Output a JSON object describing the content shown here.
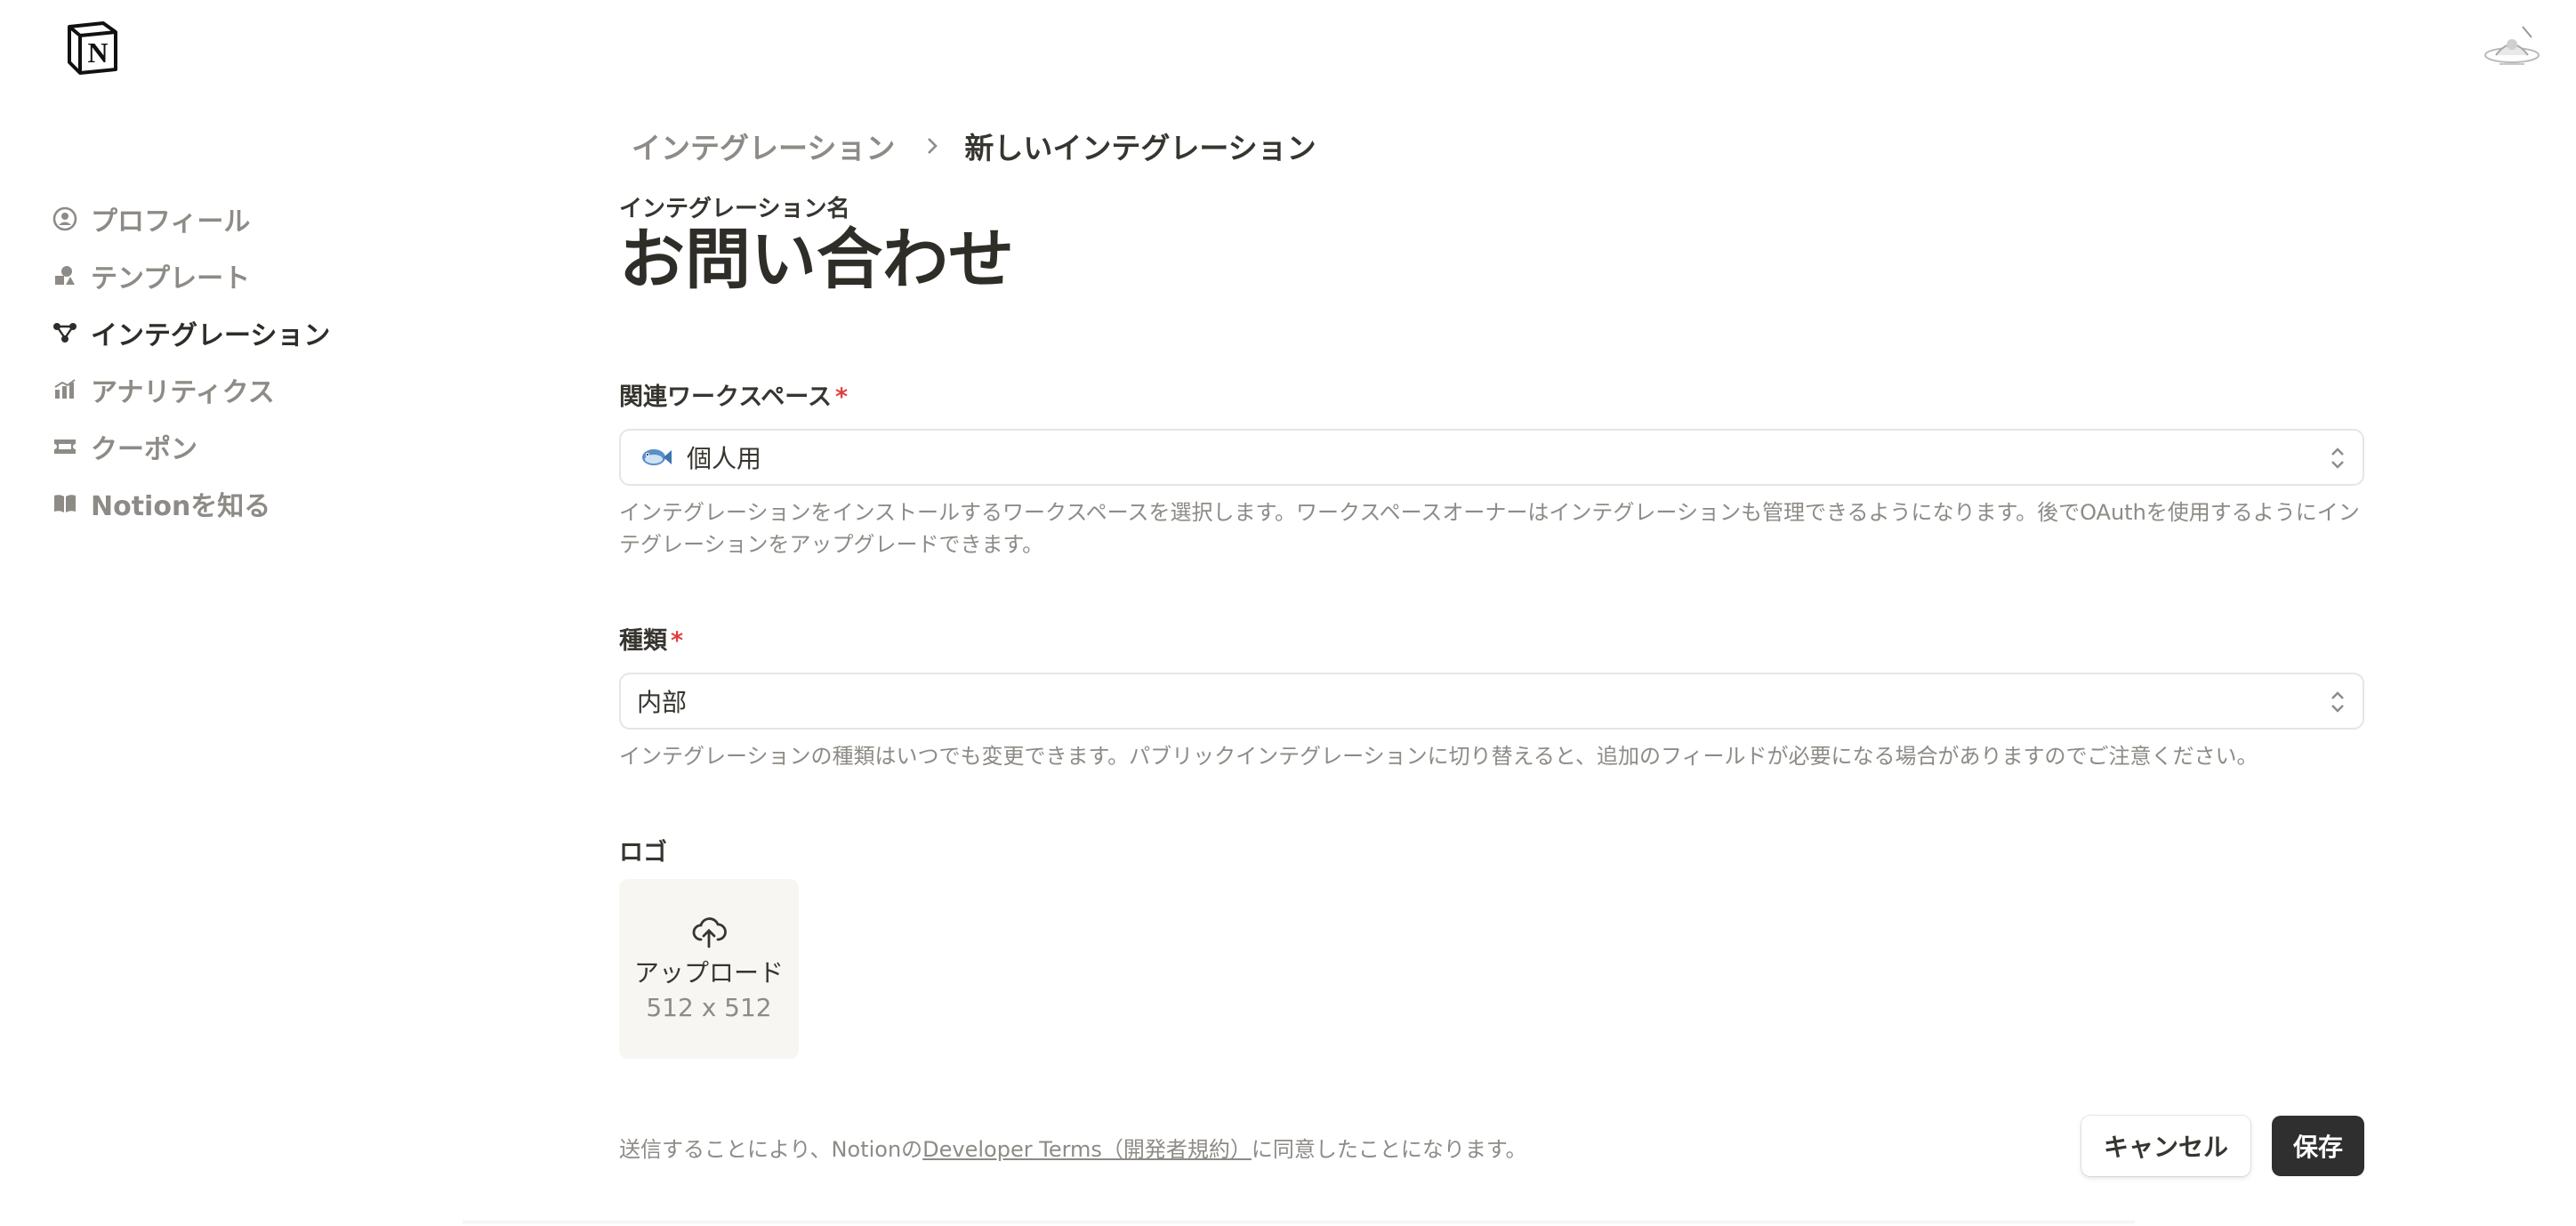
{
  "sidebar": {
    "items": [
      {
        "label": "プロフィール",
        "icon": "profile-icon"
      },
      {
        "label": "テンプレート",
        "icon": "template-icon"
      },
      {
        "label": "インテグレーション",
        "icon": "integration-icon",
        "active": true
      },
      {
        "label": "アナリティクス",
        "icon": "analytics-icon"
      },
      {
        "label": "クーポン",
        "icon": "coupon-icon"
      },
      {
        "label": "Notionを知る",
        "icon": "book-icon"
      }
    ]
  },
  "breadcrumb": {
    "parent": "インテグレーション",
    "current": "新しいインテグレーション"
  },
  "integration": {
    "name_label": "インテグレーション名",
    "name_value": "お問い合わせ"
  },
  "workspace": {
    "label": "関連ワークスペース",
    "required_mark": "*",
    "value": "個人用",
    "value_icon": "fish-emoji",
    "help": "インテグレーションをインストールするワークスペースを選択します。ワークスペースオーナーはインテグレーションも管理できるようになります。後でOAuthを使用するようにインテグレーションをアップグレードできます。"
  },
  "type": {
    "label": "種類",
    "required_mark": "*",
    "value": "内部",
    "help": "インテグレーションの種類はいつでも変更できます。パブリックインテグレーションに切り替えると、追加のフィールドが必要になる場合がありますのでご注意ください。"
  },
  "logo": {
    "label": "ロゴ",
    "upload_label": "アップロード",
    "upload_size": "512 x 512"
  },
  "footer": {
    "text_before": "送信することにより、Notionの",
    "link": "Developer Terms（開発者規約）",
    "text_after": "に同意したことになります。"
  },
  "buttons": {
    "cancel": "キャンセル",
    "save": "保存"
  },
  "colors": {
    "required": "#e03e3e",
    "save_bg": "#2f2f2f",
    "text": "#37352f",
    "muted": "#8e8b86"
  }
}
